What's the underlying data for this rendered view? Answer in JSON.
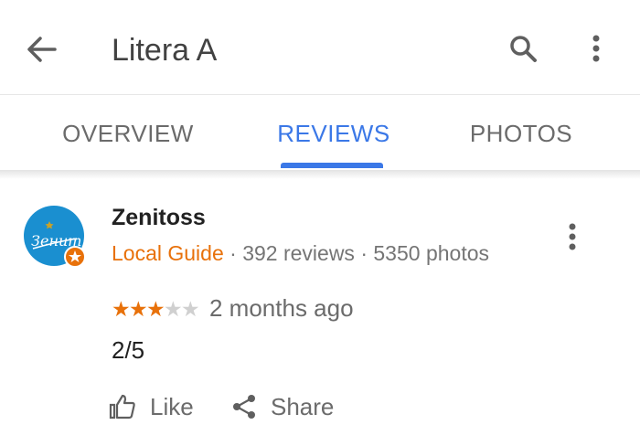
{
  "appbar": {
    "title": "Litera A",
    "back_icon": "arrow-left-icon",
    "search_icon": "search-icon",
    "more_icon": "more-vert-icon"
  },
  "tabs": [
    {
      "label": "OVERVIEW",
      "selected": false
    },
    {
      "label": "REVIEWS",
      "selected": true
    },
    {
      "label": "PHOTOS",
      "selected": false
    }
  ],
  "review": {
    "reviewer": "Zenitoss",
    "badge": "Local Guide",
    "reviews_count": "392 reviews",
    "photos_count": "5350 photos",
    "separator": " · ",
    "rating": 3,
    "max_rating": 5,
    "date": "2 months ago",
    "text": "2/5",
    "actions": {
      "like": "Like",
      "share": "Share"
    }
  },
  "colors": {
    "accent": "#3b78e7",
    "local_guide": "#e8710a",
    "star_on": "#e8710a",
    "star_off": "#d0d0d0",
    "avatar_bg": "#1a8fd0"
  }
}
